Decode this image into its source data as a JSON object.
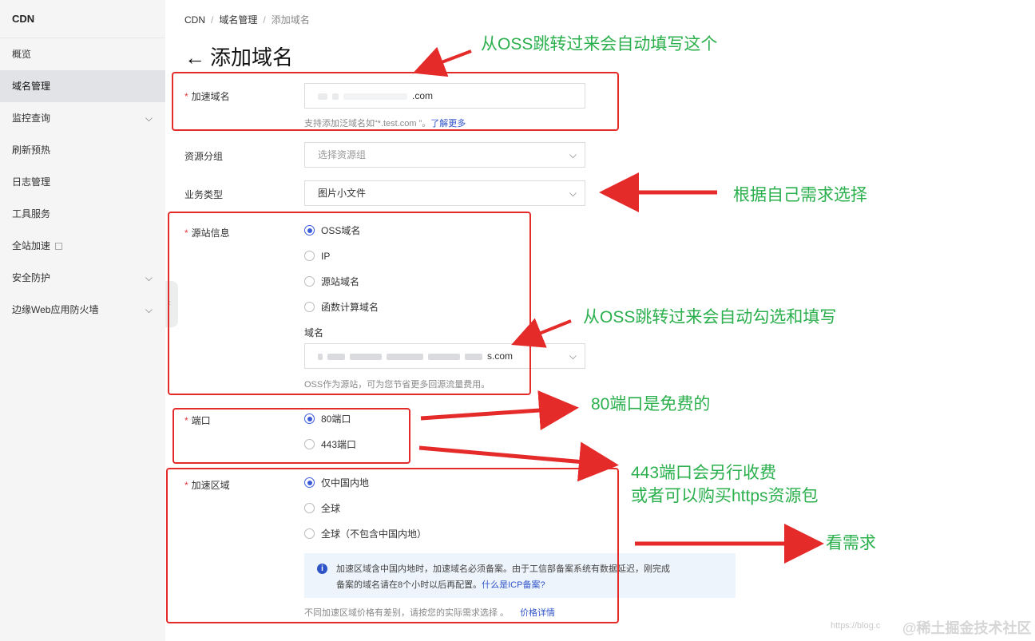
{
  "sidebar": {
    "title": "CDN",
    "items": [
      {
        "label": "概览",
        "chevron": false,
        "external": false,
        "active": false
      },
      {
        "label": "域名管理",
        "chevron": false,
        "external": false,
        "active": true
      },
      {
        "label": "监控查询",
        "chevron": true,
        "external": false,
        "active": false
      },
      {
        "label": "刷新预热",
        "chevron": false,
        "external": false,
        "active": false
      },
      {
        "label": "日志管理",
        "chevron": false,
        "external": false,
        "active": false
      },
      {
        "label": "工具服务",
        "chevron": false,
        "external": false,
        "active": false
      },
      {
        "label": "全站加速",
        "chevron": false,
        "external": true,
        "active": false
      },
      {
        "label": "安全防护",
        "chevron": true,
        "external": false,
        "active": false
      },
      {
        "label": "边缘Web应用防火墙",
        "chevron": true,
        "external": false,
        "active": false
      }
    ]
  },
  "breadcrumb": {
    "root": "CDN",
    "parent": "域名管理",
    "current": "添加域名"
  },
  "page": {
    "back_arrow": "←",
    "title": "添加域名"
  },
  "form": {
    "accel_domain": {
      "label": "加速域名",
      "value_suffix": ".com",
      "hint": "支持添加泛域名如“*.test.com ”。",
      "hint_link": "了解更多"
    },
    "resource_group": {
      "label": "资源分组",
      "placeholder": "选择资源组"
    },
    "business_type": {
      "label": "业务类型",
      "value": "图片小文件"
    },
    "origin": {
      "label": "源站信息",
      "options": [
        "OSS域名",
        "IP",
        "源站域名",
        "函数计算域名"
      ],
      "selected": 0,
      "domain_label": "域名",
      "domain_value_suffix": "s.com",
      "hint": "OSS作为源站，可为您节省更多回源流量费用。"
    },
    "port": {
      "label": "端口",
      "options": [
        "80端口",
        "443端口"
      ],
      "selected": 0
    },
    "region": {
      "label": "加速区域",
      "options": [
        "仅中国内地",
        "全球",
        "全球（不包含中国内地）"
      ],
      "selected": 0,
      "notice_line1": "加速区域含中国内地时，加速域名必须备案。由于工信部备案系统有数据延迟，刚完成",
      "notice_line2": "备案的域名请在8个小时以后再配置。",
      "notice_link": "什么是ICP备案?",
      "footer_hint": "不同加速区域价格有差别，请按您的实际需求选择 。",
      "footer_link": "价格详情"
    }
  },
  "annotations": {
    "note1": "从OSS跳转过来会自动填写这个",
    "note2": "根据自己需求选择",
    "note3": "从OSS跳转过来会自动勾选和填写",
    "note4": "80端口是免费的",
    "note5_line1": "443端口会另行收费",
    "note5_line2": "或者可以购买https资源包",
    "note6": "看需求",
    "annotation_color": "#2cb04e",
    "box_color": "#e52a2a"
  },
  "watermark": {
    "text1": "https://blog.c",
    "text2": "@稀土掘金技术社区"
  }
}
